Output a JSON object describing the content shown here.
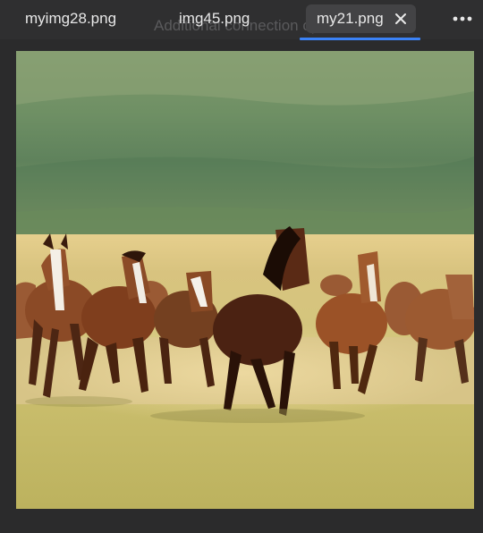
{
  "tabs": [
    {
      "label": "myimg28.png",
      "active": false
    },
    {
      "label": "img45.png",
      "active": false
    },
    {
      "label": "my21.png",
      "active": true
    }
  ],
  "background_overlay_text": "Additional connection options",
  "icons": {
    "close": "close-icon",
    "more": "more-horizontal-icon"
  },
  "colors": {
    "tab_bar": "#2f2f30",
    "active_tab": "#434345",
    "active_underline": "#3b82f6",
    "text": "#e8e8e8"
  },
  "image": {
    "subject": "herd of horses galloping across grassy steppe"
  }
}
